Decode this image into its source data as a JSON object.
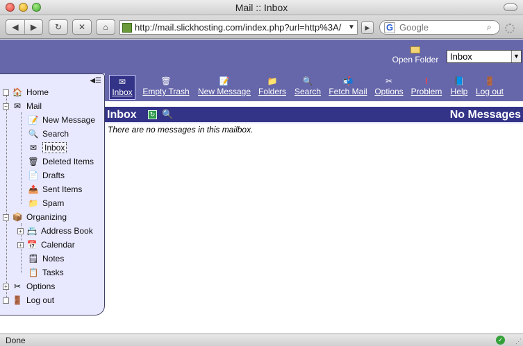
{
  "window": {
    "title": "Mail :: Inbox"
  },
  "browser": {
    "url": "http://mail.slickhosting.com/index.php?url=http%3A/",
    "search_engine_letter": "G",
    "search_placeholder": "Google"
  },
  "header": {
    "open_folder_label": "Open Folder",
    "folder_selected": "Inbox"
  },
  "sidebar": {
    "items": [
      {
        "label": "Home",
        "icon": "home-icon"
      },
      {
        "label": "Mail",
        "icon": "mail-icon"
      },
      {
        "label": "New Message",
        "icon": "compose-icon"
      },
      {
        "label": "Search",
        "icon": "search-icon"
      },
      {
        "label": "Inbox",
        "icon": "inbox-icon"
      },
      {
        "label": "Deleted Items",
        "icon": "trash-icon"
      },
      {
        "label": "Drafts",
        "icon": "drafts-icon"
      },
      {
        "label": "Sent Items",
        "icon": "sent-icon"
      },
      {
        "label": "Spam",
        "icon": "folder-icon"
      },
      {
        "label": "Organizing",
        "icon": "organizing-icon"
      },
      {
        "label": "Address Book",
        "icon": "address-book-icon"
      },
      {
        "label": "Calendar",
        "icon": "calendar-icon"
      },
      {
        "label": "Notes",
        "icon": "notes-icon"
      },
      {
        "label": "Tasks",
        "icon": "tasks-icon"
      },
      {
        "label": "Options",
        "icon": "options-icon"
      },
      {
        "label": "Log out",
        "icon": "logout-icon"
      }
    ],
    "selected": "Inbox"
  },
  "mainbar": {
    "items": [
      {
        "label": "Inbox",
        "icon": "inbox-icon"
      },
      {
        "label": "Empty Trash",
        "icon": "empty-trash-icon"
      },
      {
        "label": "New Message",
        "icon": "compose-icon"
      },
      {
        "label": "Folders",
        "icon": "folder-icon"
      },
      {
        "label": "Search",
        "icon": "search-icon"
      },
      {
        "label": "Fetch Mail",
        "icon": "fetch-mail-icon"
      },
      {
        "label": "Options",
        "icon": "options-icon"
      },
      {
        "label": "Problem",
        "icon": "problem-icon"
      },
      {
        "label": "Help",
        "icon": "help-icon"
      },
      {
        "label": "Log out",
        "icon": "logout-icon"
      }
    ],
    "active": "Inbox"
  },
  "mailbox": {
    "name": "Inbox",
    "count_text": "No Messages",
    "empty_message": "There are no messages in this mailbox."
  },
  "status": {
    "text": "Done"
  },
  "colors": {
    "header_purple": "#6666aa",
    "mailbox_head": "#333388",
    "sidebar_bg": "#e8e8ff"
  }
}
